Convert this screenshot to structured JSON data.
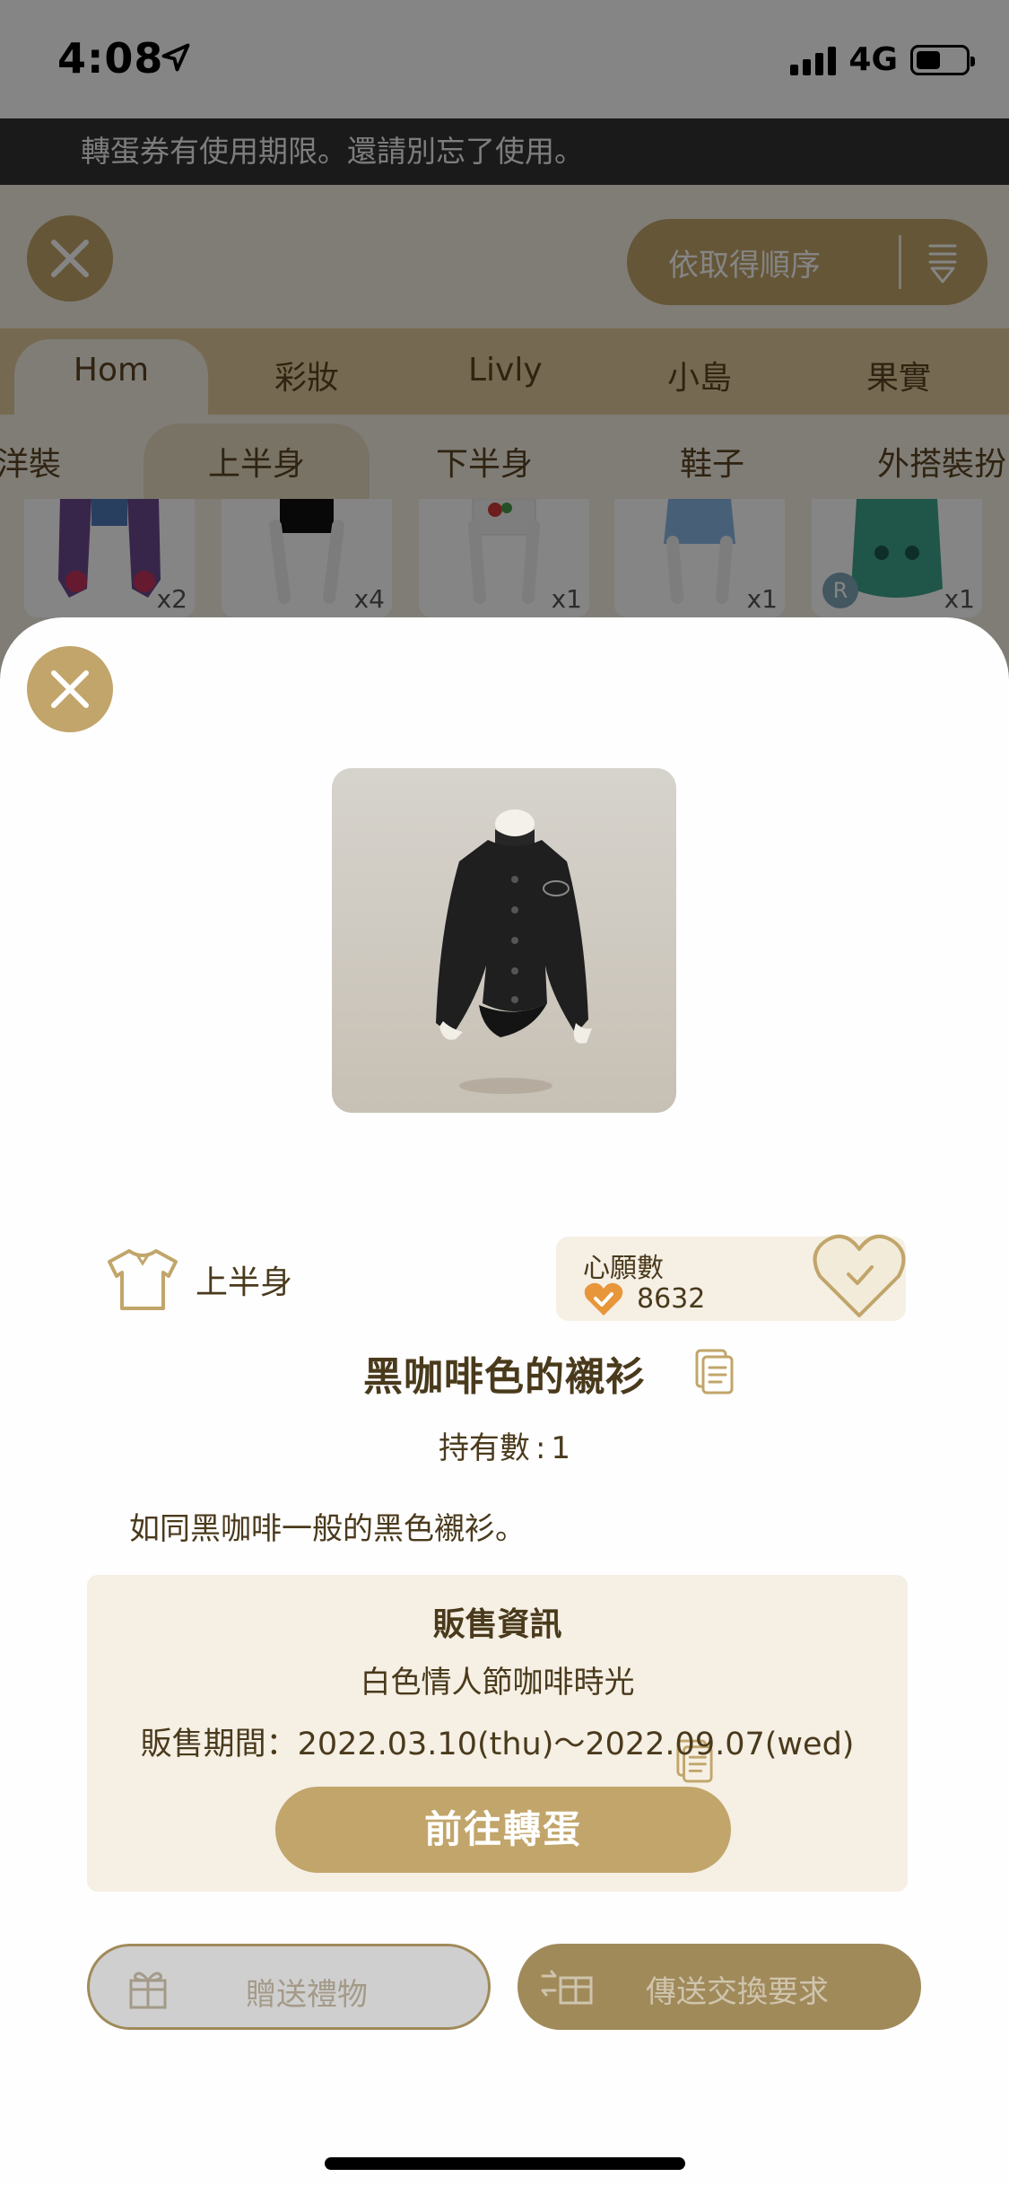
{
  "status_bar": {
    "time": "4:08",
    "network": "4G",
    "battery_level": 0.3
  },
  "notice": {
    "text": "轉蛋券有使用期限。還請別忘了使用。"
  },
  "toolbar": {
    "sort_label": "依取得順序"
  },
  "main_tabs": [
    {
      "label": "Hom",
      "active": true
    },
    {
      "label": "彩妝"
    },
    {
      "label": "Livly"
    },
    {
      "label": "小島"
    },
    {
      "label": "果實"
    }
  ],
  "sub_tabs": [
    {
      "label": "洋裝"
    },
    {
      "label": "上半身",
      "active": true
    },
    {
      "label": "下半身"
    },
    {
      "label": "鞋子"
    },
    {
      "label": "外搭裝扮"
    }
  ],
  "items": [
    {
      "qty": "x2"
    },
    {
      "qty": "x4"
    },
    {
      "qty": "x1"
    },
    {
      "qty": "x1"
    },
    {
      "qty": "x1",
      "badge": "R"
    }
  ],
  "detail": {
    "category": "上半身",
    "wish_title": "心願數",
    "wish_count": "8632",
    "name": "黑咖啡色的襯衫",
    "owned_label": "持有數",
    "owned_colon": ":",
    "owned_value": "1",
    "description": "如同黑咖啡一般的黑色襯衫。",
    "sale": {
      "title": "販售資訊",
      "event": "白色情人節咖啡時光",
      "period": "販售期間：2022.03.10(thu)～2022.09.07(wed)",
      "button": "前往轉蛋"
    },
    "gift_button": "贈送禮物",
    "trade_button": "傳送交換要求"
  },
  "colors": {
    "accent_gold": "#c1a56a",
    "text_brown": "#4a3a1c",
    "panel_cream": "#f5efe4"
  }
}
